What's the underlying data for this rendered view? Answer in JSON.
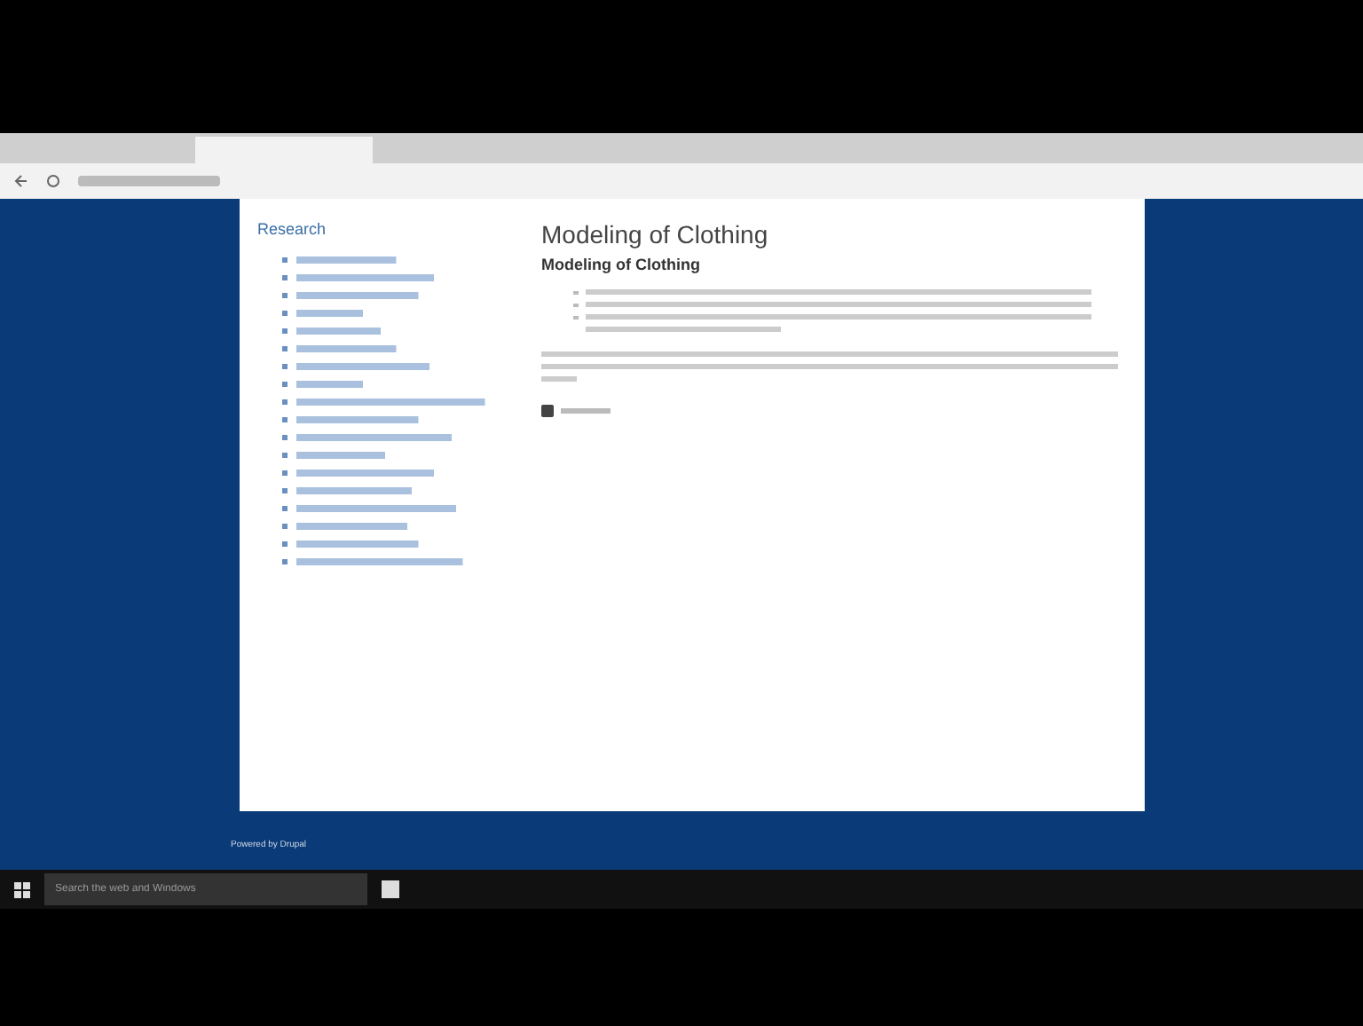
{
  "sidebar": {
    "title": "Research"
  },
  "article": {
    "title": "Modeling of Clothing",
    "subtitle": "Modeling of Clothing"
  },
  "footer": {
    "text": "Powered by Drupal"
  },
  "taskbar": {
    "search": {
      "placeholder": "Search the web and Windows"
    }
  }
}
